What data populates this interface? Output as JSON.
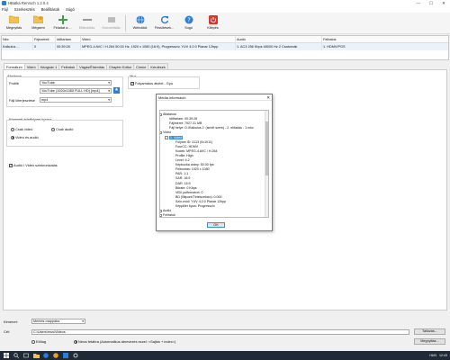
{
  "window": {
    "title": "HBatka Renroch 1.2.0.4",
    "controls": [
      "—",
      "☐",
      "✕"
    ]
  },
  "menu": [
    "Fájl",
    "Szerkesztés",
    "Beállítások",
    "Súgó"
  ],
  "toolbar": {
    "open": "Megnyitás",
    "remove": "Mégsem",
    "add_task": "Feladat a ...",
    "erase": "Eltávolítás",
    "convert": "Konvertálás",
    "website": "Weboldal",
    "update": "Frissítések...",
    "help": "Súgó",
    "exit": "Kilépés"
  },
  "queue": {
    "headers": [
      "Név",
      "Fejezetek",
      "Időtartam",
      "Videó",
      "Audió",
      "Feliratok"
    ],
    "rows": [
      [
        "Kalkulus ...",
        "0",
        "00:39:28",
        "MPEG-4 AVC / H.264 50.00 Hz, 1920 x 1080 (16:9), Progresszív, YUV 4:2:0 Planar 12bpp",
        "1. AC3 256 Kbps 48000 Hz 2 Csatornák",
        "1. HDMV/PGS"
      ]
    ]
  },
  "tabs": [
    "Formátum",
    "Videó",
    "Hangsáv 1",
    "Feliratok",
    "Vágás/Élsimítás",
    "Chapter Editor",
    "Címke",
    "Kérdések"
  ],
  "format": {
    "general_label": "Általános",
    "profile_label": "Profilb",
    "profile_value": "YouTube",
    "subprofile_value": "YouTube (1920x1080 FULL HD) [mp4]",
    "file_format_label": "Fájl kiterjesztése",
    "file_format_value": "mp4",
    "misc_label": "Mux",
    "compat_check": "Folyamatos átvitel - Gyu",
    "stream_type_label": "Kimeneti adatfolyam típusa",
    "video_only": "Csak videó",
    "audio_only": "Csak audió",
    "video_audio": "Videó és audió",
    "sync_check": "Audió / Videó szinkronizálás"
  },
  "dialog": {
    "title": "Média információ",
    "close": "✕",
    "ok": "OK",
    "tree": [
      {
        "text": "Általános",
        "level": 0,
        "toggle": "-"
      },
      {
        "text": "Időtartam: 00:39:28",
        "level": 1
      },
      {
        "text": "Fájlméret: 7927.31 MB",
        "level": 1
      },
      {
        "text": "Fájl helye: D:\\Kalkulus 2. (ismét szem) - 2. előadás - 1.mkv",
        "level": 1
      },
      {
        "text": "Videó",
        "level": 0,
        "toggle": "-"
      },
      {
        "text": "1. Videó",
        "level": 1,
        "toggle": "-",
        "selected": true
      },
      {
        "text": "Folyam ID: 4113 (0x1011)",
        "level": 2
      },
      {
        "text": "FourCC: HDMV",
        "level": 2
      },
      {
        "text": "Kodek: MPEG-4 AVC / H.264",
        "level": 2
      },
      {
        "text": "Profile: High",
        "level": 2
      },
      {
        "text": "Level: 4.2",
        "level": 2
      },
      {
        "text": "Képkocka arány: 50.00 fps",
        "level": 2
      },
      {
        "text": "Felbontás: 1920 x 1080",
        "level": 2
      },
      {
        "text": "PAR: 1:1",
        "level": 2
      },
      {
        "text": "SAR: 16:9",
        "level": 2
      },
      {
        "text": "DAR: 16:9",
        "level": 2
      },
      {
        "text": "Bitrate: 0 Kbps",
        "level": 2
      },
      {
        "text": "VBV pufferméret: 0",
        "level": 2
      },
      {
        "text": "BD (Bitpont/Tételszekció): 0.000",
        "level": 2
      },
      {
        "text": "Szín-mód: YUV 4:2:0 Planar 12bpp",
        "level": 2
      },
      {
        "text": "Képpillér típus: Progresszív",
        "level": 2
      },
      {
        "text": "Audió",
        "level": 0,
        "toggle": "+"
      },
      {
        "text": "Feliratok",
        "level": 0,
        "toggle": "+"
      }
    ]
  },
  "bottom": {
    "output_label": "Kimenet:",
    "output_value": "Mentés mappába",
    "dest_label": "Cél:",
    "dest_value": "C:\\Users\\mus\\Videos",
    "browse": "Tallózás...",
    "radio_prefix": "Előtag",
    "radio_suffix": "Nincs fetátíra (Automatikus átnevezés ezzel: <Sajtos + index>)",
    "open_btn": "Megnyitás..."
  },
  "taskbar": {
    "lang": "HUN",
    "time": "12:43"
  },
  "colors": {
    "accent": "#3b8ed8",
    "selected_row": "#eaf2fb"
  }
}
